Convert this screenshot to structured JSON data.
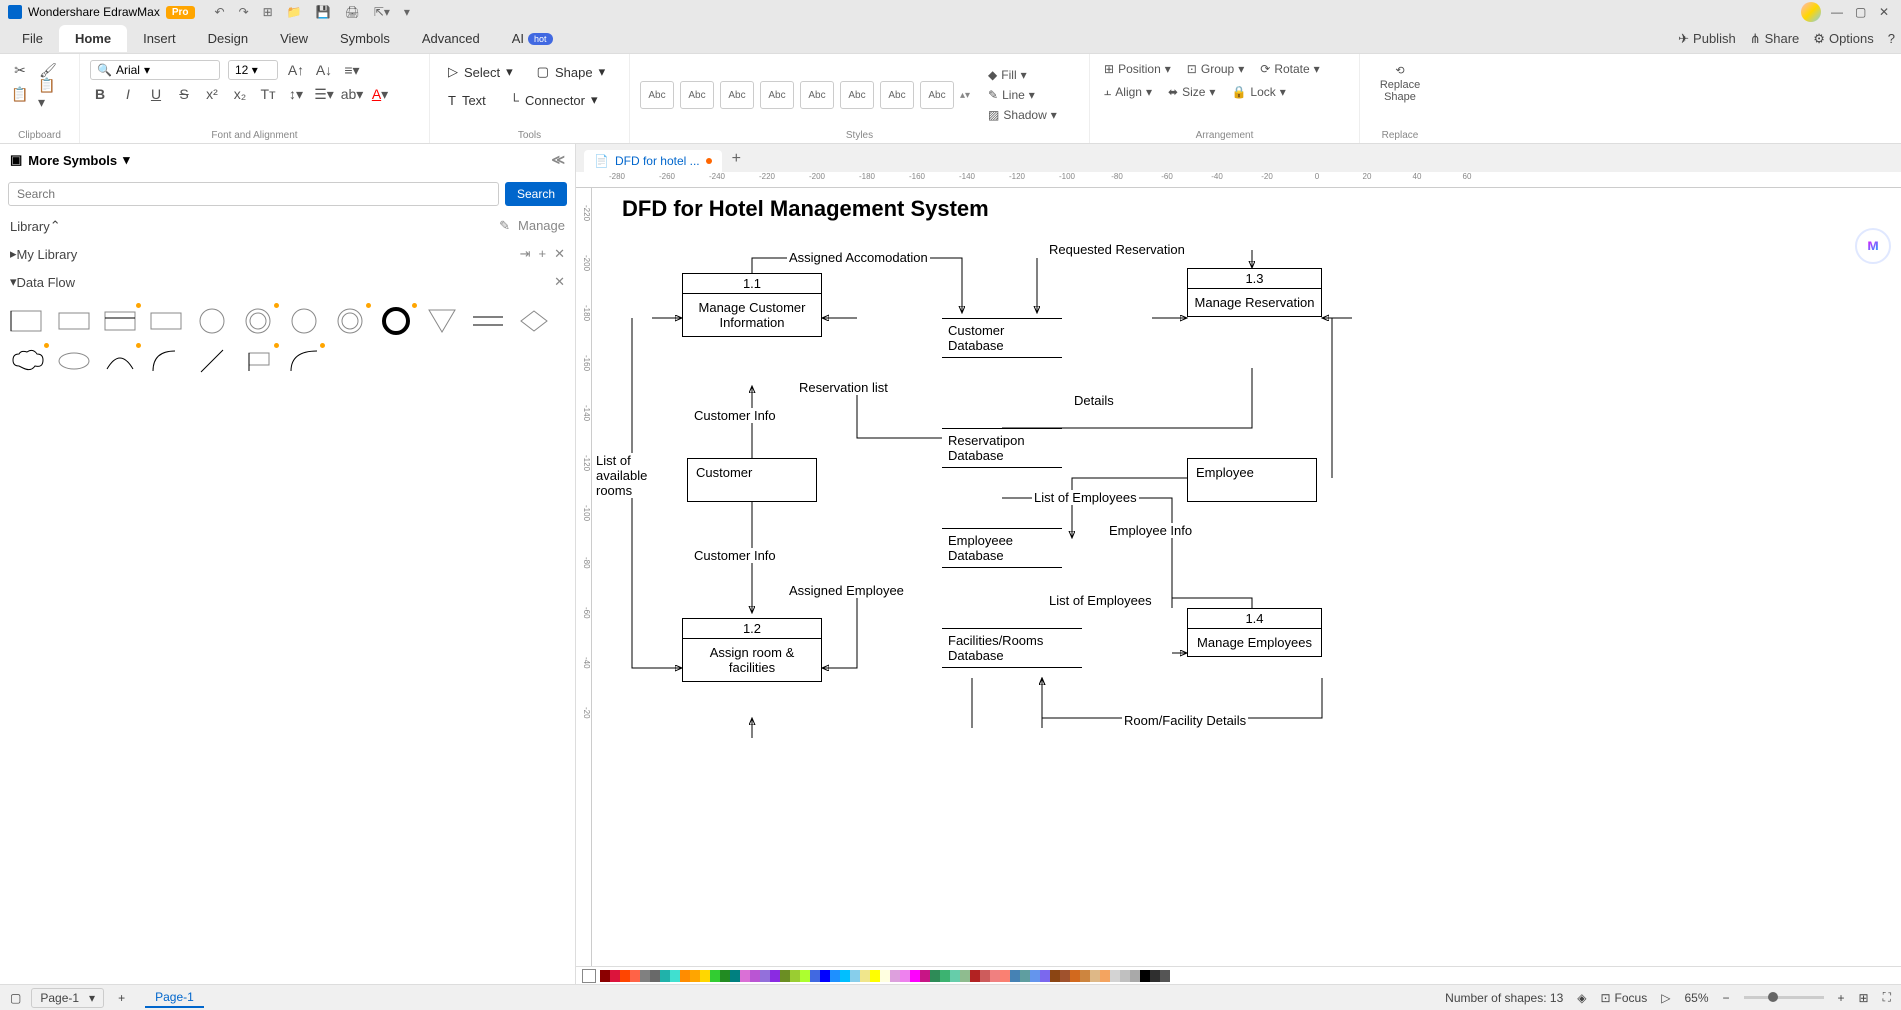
{
  "app": {
    "title": "Wondershare EdrawMax",
    "badge": "Pro"
  },
  "menu": {
    "tabs": [
      "File",
      "Home",
      "Insert",
      "Design",
      "View",
      "Symbols",
      "Advanced"
    ],
    "active": 1,
    "ai": "AI",
    "hot": "hot",
    "right": {
      "publish": "Publish",
      "share": "Share",
      "options": "Options"
    }
  },
  "ribbon": {
    "clipboard": "Clipboard",
    "font_name": "Arial",
    "font_size": "12",
    "font_align": "Font and Alignment",
    "select": "Select",
    "shape": "Shape",
    "text": "Text",
    "connector": "Connector",
    "tools": "Tools",
    "style_label": "Abc",
    "styles": "Styles",
    "fill": "Fill",
    "line": "Line",
    "shadow": "Shadow",
    "position": "Position",
    "group": "Group",
    "rotate": "Rotate",
    "align": "Align",
    "size": "Size",
    "lock": "Lock",
    "arrangement": "Arrangement",
    "replace_shape": "Replace\nShape",
    "replace": "Replace"
  },
  "left_panel": {
    "more_symbols": "More Symbols",
    "search_placeholder": "Search",
    "search_btn": "Search",
    "library": "Library",
    "manage": "Manage",
    "my_library": "My Library",
    "category": "Data Flow"
  },
  "document": {
    "tab_name": "DFD for hotel ..."
  },
  "ruler_h": [
    "-280",
    "-260",
    "-240",
    "-220",
    "-200",
    "-180",
    "-160",
    "-140",
    "-120",
    "-100",
    "-80",
    "-60",
    "-40",
    "-20",
    "0",
    "20",
    "40",
    "60"
  ],
  "ruler_v": [
    "-220",
    "-200",
    "-180",
    "-160",
    "-140",
    "-120",
    "-100",
    "-80",
    "-60",
    "-40",
    "-20"
  ],
  "diagram": {
    "title": "DFD for Hotel Management System",
    "processes": {
      "p11": {
        "num": "1.1",
        "name": "Manage Customer Information"
      },
      "p12": {
        "num": "1.2",
        "name": "Assign room & facilities"
      },
      "p13": {
        "num": "1.3",
        "name": "Manage Reservation"
      },
      "p14": {
        "num": "1.4",
        "name": "Manage Employees"
      }
    },
    "entities": {
      "customer": "Customer",
      "employee": "Employee"
    },
    "datastores": {
      "cust_db": "Customer Database",
      "res_db": "Reservatipon Database",
      "emp_db": "Employeee Database",
      "fac_db": "Facilities/Rooms Database"
    },
    "flows": {
      "assigned_accom": "Assigned Accomodation",
      "req_res": "Requested Reservation",
      "res_list": "Reservation list",
      "cust_info1": "Customer Info",
      "cust_info2": "Customer Info",
      "list_rooms": "List of available rooms",
      "details": "Details",
      "list_emp1": "List of Employees",
      "list_emp2": "List of Employees",
      "emp_info": "Employee Info",
      "assigned_emp": "Assigned Employee",
      "room_details": "Room/Facility Details"
    }
  },
  "status": {
    "page_sel": "Page-1",
    "page_tab": "Page-1",
    "shapes": "Number of shapes: 13",
    "focus": "Focus",
    "zoom": "65%"
  },
  "colors": [
    "#8b0000",
    "#dc143c",
    "#ff4500",
    "#ff6347",
    "#808080",
    "#696969",
    "#20b2aa",
    "#40e0d0",
    "#ff8c00",
    "#ffa500",
    "#ffd700",
    "#32cd32",
    "#228b22",
    "#008080",
    "#da70d6",
    "#ba55d3",
    "#9370db",
    "#8a2be2",
    "#6b8e23",
    "#9acd32",
    "#adff2f",
    "#4169e1",
    "#0000ff",
    "#1e90ff",
    "#00bfff",
    "#87ceeb",
    "#f0e68c",
    "#ffff00",
    "#ffffe0",
    "#dda0dd",
    "#ee82ee",
    "#ff00ff",
    "#c71585",
    "#2e8b57",
    "#3cb371",
    "#66cdaa",
    "#8fbc8f",
    "#b22222",
    "#cd5c5c",
    "#f08080",
    "#fa8072",
    "#4682b4",
    "#5f9ea0",
    "#6495ed",
    "#7b68ee",
    "#8b4513",
    "#a0522d",
    "#d2691e",
    "#cd853f",
    "#deb887",
    "#f4a460",
    "#d3d3d3",
    "#c0c0c0",
    "#a9a9a9",
    "#000000",
    "#2f2f2f",
    "#555555"
  ]
}
